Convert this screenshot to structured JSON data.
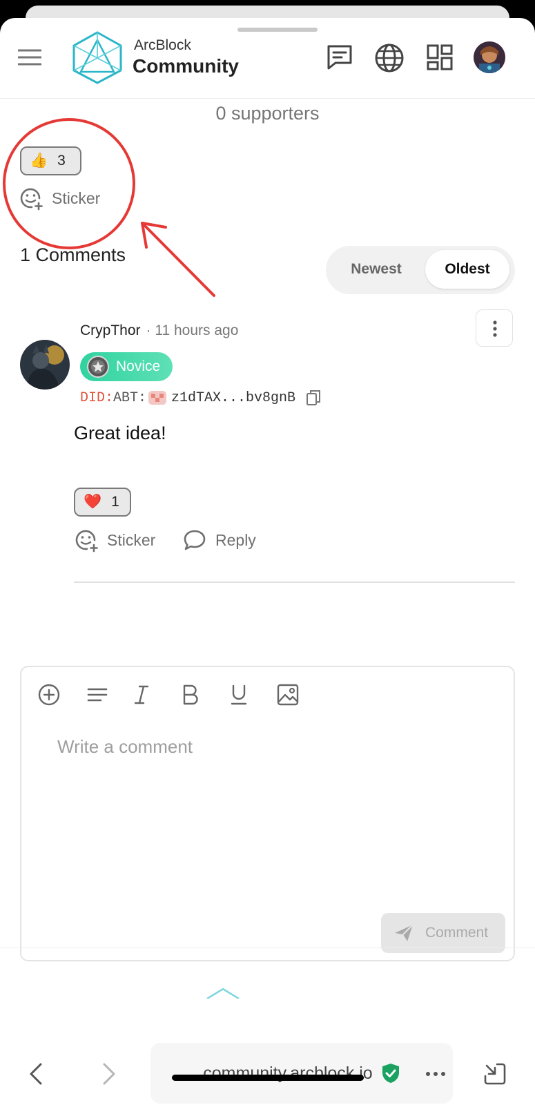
{
  "header": {
    "brand_sub": "ArcBlock",
    "brand_main": "Community"
  },
  "post": {
    "supporters": "0 supporters",
    "reaction": {
      "emoji": "👍",
      "count": "3"
    },
    "sticker_label": "Sticker"
  },
  "comments": {
    "title": "1 Comments",
    "sort_options": [
      "Newest",
      "Oldest"
    ],
    "selected_sort": "Oldest",
    "items": [
      {
        "author": "CrypThor",
        "time": "· 11 hours ago",
        "badge": "Novice",
        "did_prefix": "DID:",
        "did_chain": "ABT:",
        "did_value": "z1dTAX...bv8gnB",
        "body": "Great idea!",
        "reaction": {
          "emoji": "❤️",
          "count": "1"
        },
        "sticker_label": "Sticker",
        "reply_label": "Reply"
      }
    ]
  },
  "editor": {
    "placeholder": "Write a comment",
    "submit_label": "Comment"
  },
  "browser": {
    "url": "community.arcblock.io"
  },
  "colors": {
    "annotation_red": "#e53935",
    "badge_green": "#2fd3a0",
    "verified_green": "#1aa260",
    "did_prefix": "#e0523a",
    "logo_teal": "#2bb6c8"
  }
}
